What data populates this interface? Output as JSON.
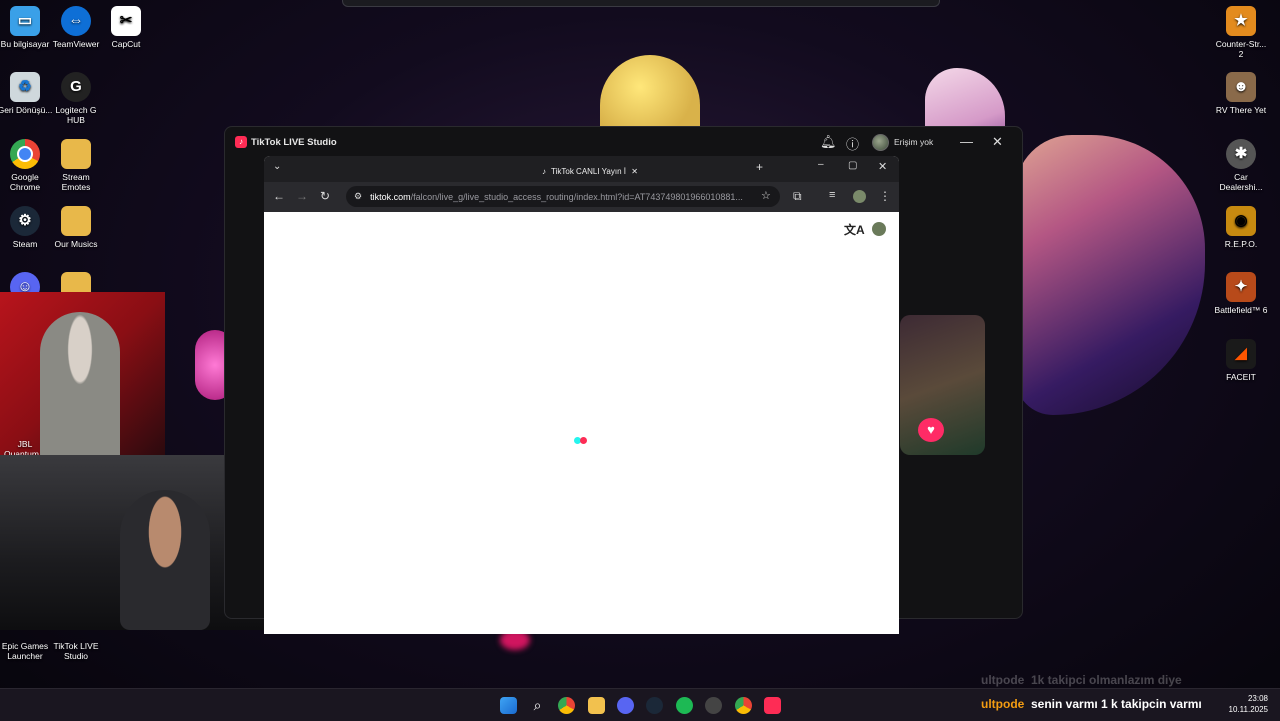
{
  "desktop_left": [
    {
      "label": "Bu bilgisayar",
      "icon": "monitor-icon",
      "color": "#3aa0e8"
    },
    {
      "label": "TeamViewer",
      "icon": "teamviewer-icon",
      "color": "#0e6fd6"
    },
    {
      "label": "CapCut",
      "icon": "capcut-icon",
      "color": "#ffffff"
    },
    {
      "label": "Geri Dönüşü...",
      "icon": "recycle-bin-icon",
      "color": "#cfd8dc"
    },
    {
      "label": "Logitech G HUB",
      "icon": "logitech-icon",
      "color": "#222222"
    },
    {
      "label": "Google Chrome",
      "icon": "chrome-icon",
      "color": "#34a853"
    },
    {
      "label": "Stream Emotes",
      "icon": "folder-icon",
      "color": "#e8b84a"
    },
    {
      "label": "Steam",
      "icon": "steam-icon",
      "color": "#1b2838"
    },
    {
      "label": "Our Musics",
      "icon": "folder-icon",
      "color": "#e8b84a"
    },
    {
      "label": "JBL Quantum...",
      "icon": "jbl-icon",
      "color": "#ff6a00"
    },
    {
      "label": "Epic Games Launcher",
      "icon": "epic-icon",
      "color": "#2a2a2a"
    },
    {
      "label": "TikTok LIVE Studio",
      "icon": "tiktok-icon",
      "color": "#fe2c55"
    }
  ],
  "desktop_right": [
    {
      "label": "Counter-Str... 2",
      "icon": "cs2-icon",
      "color": "#e38b1e"
    },
    {
      "label": "RV There Yet",
      "icon": "rv-icon",
      "color": "#8a6a4a"
    },
    {
      "label": "Car Dealershi...",
      "icon": "car-icon",
      "color": "#555555"
    },
    {
      "label": "R.E.P.O.",
      "icon": "repo-icon",
      "color": "#c78a10"
    },
    {
      "label": "Battlefield™ 6",
      "icon": "battlefield-icon",
      "color": "#b84a1a"
    },
    {
      "label": "FACEIT",
      "icon": "faceit-icon",
      "color": "#ff5500"
    }
  ],
  "studio": {
    "title": "TikTok LIVE Studio",
    "user_status": "Erişim yok"
  },
  "browser": {
    "tab_title": "TikTok CANLI Yayın İ",
    "url_host": "tiktok.com",
    "url_path": "/falcon/live_g/live_studio_access_routing/index.html?id=AT7437498019660108​81..."
  },
  "chat": {
    "ghost_user": "ultpode",
    "ghost_text": "1k takipci olmanlazım diye",
    "user": "ultpode",
    "text": "senin varmı 1 k takipcin varmı"
  },
  "clock": {
    "time": "23:08",
    "date": "10.11.2025"
  },
  "colors": {
    "tiktok_cyan": "#25f4ee",
    "tiktok_red": "#fe2c55"
  }
}
